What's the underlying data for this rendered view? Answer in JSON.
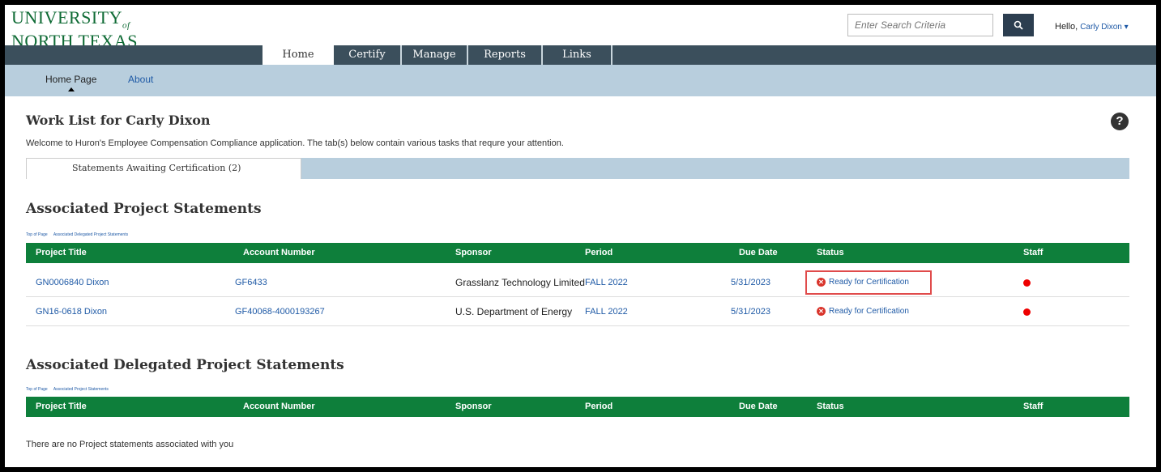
{
  "brand": {
    "line1": "UNIVERSITY",
    "of": "of",
    "line2": "NORTH TEXAS"
  },
  "search": {
    "placeholder": "Enter Search Criteria",
    "icon": "search-icon"
  },
  "user": {
    "greeting": "Hello,",
    "name": "Carly Dixon ▾"
  },
  "nav": {
    "tabs": [
      "Home",
      "Certify",
      "Manage",
      "Reports",
      "Links"
    ],
    "active": "Home"
  },
  "subnav": {
    "items": [
      "Home Page",
      "About"
    ],
    "active": "Home Page"
  },
  "page": {
    "title": "Work List for Carly Dixon",
    "welcome": "Welcome to Huron's Employee Compensation Compliance application. The tab(s) below contain various tasks that requre your attention."
  },
  "tab": {
    "label": "Statements Awaiting Certification (2)"
  },
  "columns": [
    "Project Title",
    "Account Number",
    "Sponsor",
    "Period",
    "Due Date",
    "Status",
    "Staff"
  ],
  "section1": {
    "title": "Associated Project Statements",
    "links": [
      "Top of Page",
      "Associated Delegated Project Statements"
    ],
    "rows": [
      {
        "project": "GN0006840 Dixon",
        "account": "GF6433",
        "sponsor": "Grasslanz Technology Limited",
        "period": "FALL 2022",
        "due": "5/31/2023",
        "status": "Ready for Certification"
      },
      {
        "project": "GN16-0618 Dixon",
        "account": "GF40068-4000193267",
        "sponsor": "U.S. Department of Energy",
        "period": "FALL 2022",
        "due": "5/31/2023",
        "status": "Ready for Certification"
      }
    ]
  },
  "section2": {
    "title": "Associated Delegated Project Statements",
    "links": [
      "Top of Page",
      "Associated Project Statements"
    ],
    "empty": "There are no Project statements associated with you"
  },
  "colors": {
    "green": "#0e7f3b",
    "navbar": "#3b4f5c",
    "subnav": "#b8cedd",
    "status_icon": "#d9342b",
    "link": "#1f5aa6"
  }
}
